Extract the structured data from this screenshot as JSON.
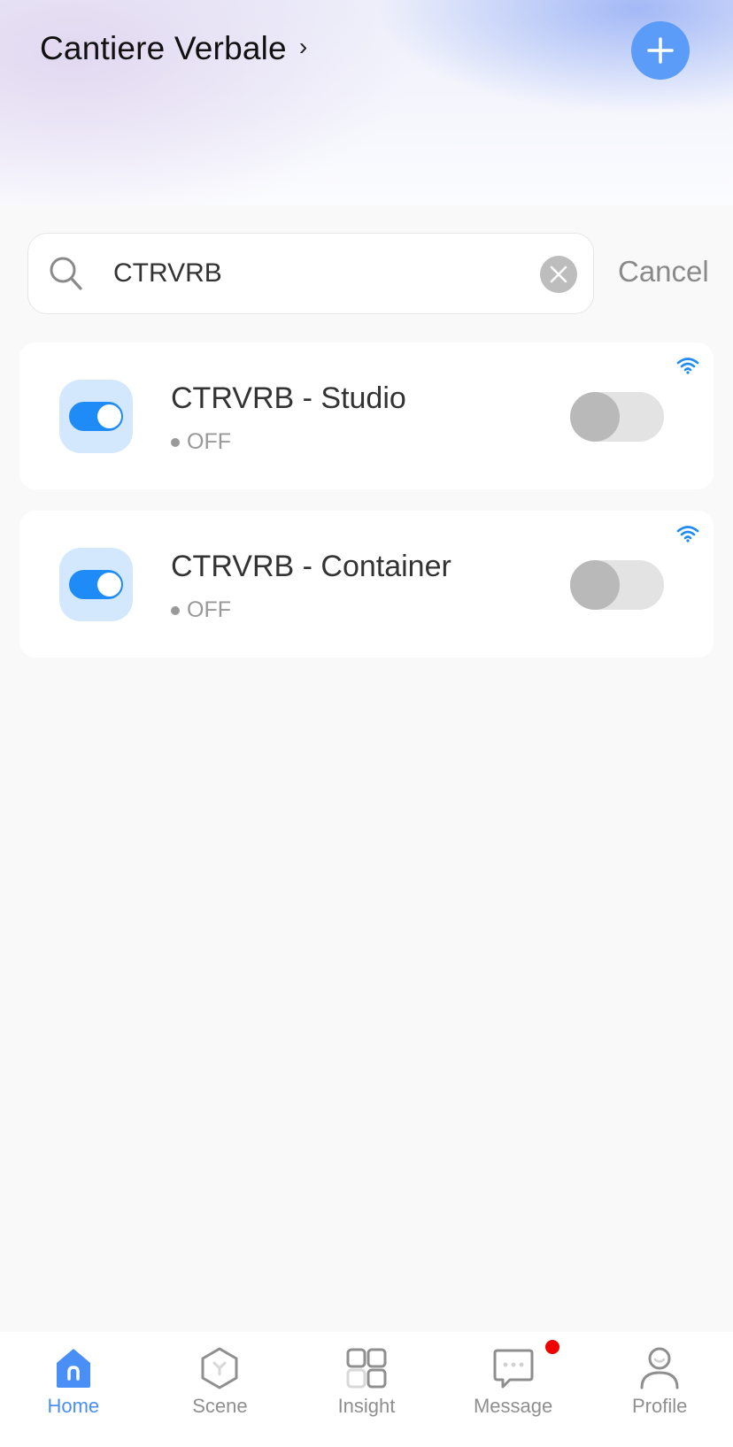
{
  "header": {
    "home_name": "Cantiere Verbale",
    "chevron": "›",
    "add_icon": "plus-icon"
  },
  "search": {
    "value": "CTRVRB",
    "placeholder": "",
    "cancel_label": "Cancel"
  },
  "devices": [
    {
      "name": "CTRVRB - Studio",
      "status": "OFF",
      "power_on": false,
      "connection": "wifi"
    },
    {
      "name": "CTRVRB - Container",
      "status": "OFF",
      "power_on": false,
      "connection": "wifi"
    }
  ],
  "tabs": [
    {
      "label": "Home",
      "icon": "home-icon",
      "active": true
    },
    {
      "label": "Scene",
      "icon": "scene-icon",
      "active": false
    },
    {
      "label": "Insight",
      "icon": "insight-icon",
      "active": false
    },
    {
      "label": "Message",
      "icon": "message-icon",
      "active": false,
      "badge": true
    },
    {
      "label": "Profile",
      "icon": "profile-icon",
      "active": false
    }
  ],
  "colors": {
    "accent": "#4a8ff5",
    "add_button": "#5b9cf8",
    "device_icon_bg": "#d3e8fd",
    "device_icon_toggle": "#1e8bf6",
    "badge": "#f00000",
    "wifi": "#1e8bf6"
  }
}
